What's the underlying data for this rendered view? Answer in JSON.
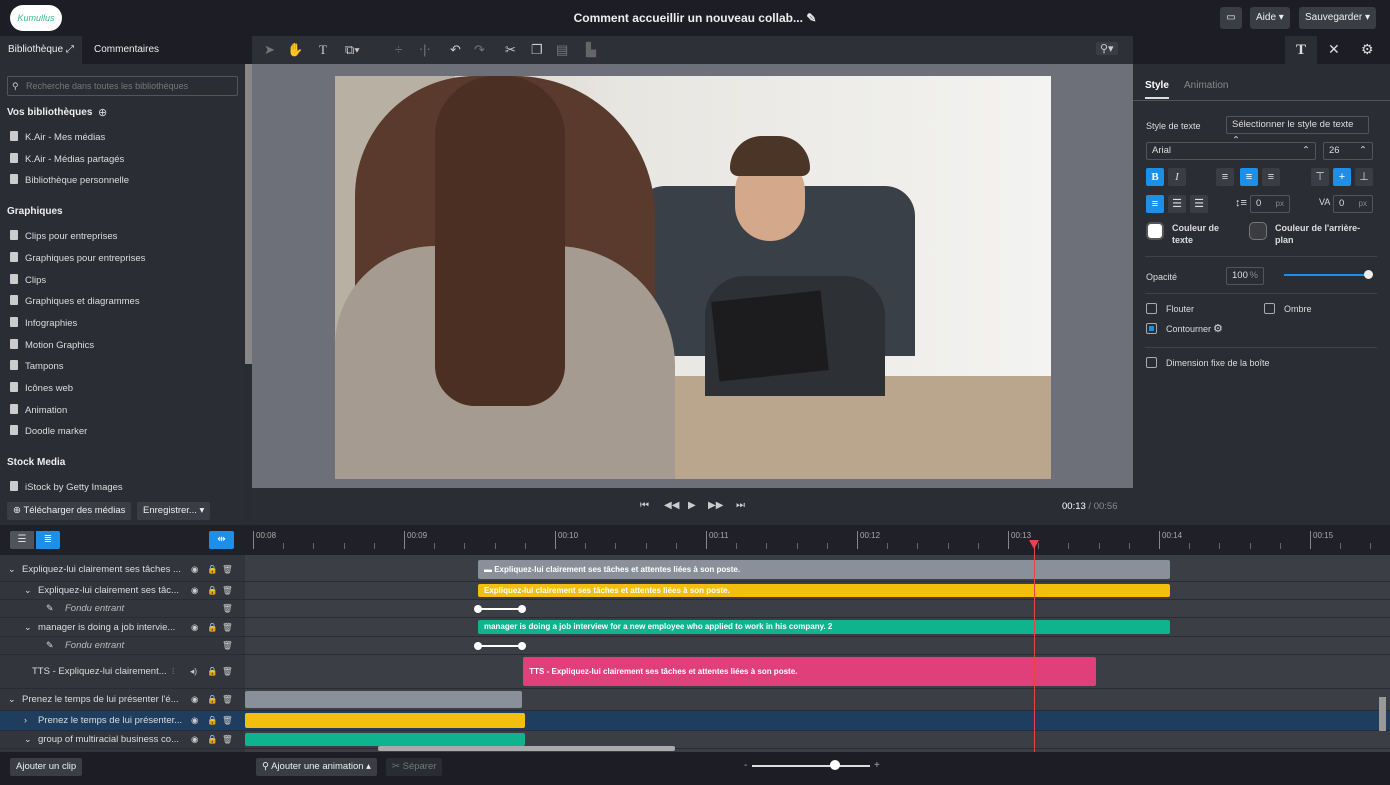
{
  "app": {
    "logo_text": "Kumullus",
    "title": "Comment accueillir un nouveau collab...",
    "help": "Aide",
    "save": "Sauvegarder"
  },
  "left": {
    "tabs": [
      "Bibliothèque",
      "Commentaires"
    ],
    "search_placeholder": "Recherche dans toutes les bibliothèques",
    "sections": [
      {
        "title": "Vos bibliothèques",
        "items": [
          "K.Air - Mes médias",
          "K.Air - Médias partagés",
          "Bibliothèque personnelle"
        ]
      },
      {
        "title": "Graphiques",
        "items": [
          "Clips pour entreprises",
          "Graphiques pour entreprises",
          "Clips",
          "Graphiques et diagrammes",
          "Infographies",
          "Motion Graphics",
          "Tampons",
          "Icônes web",
          "Animation",
          "Doodle marker"
        ]
      },
      {
        "title": "Stock Media",
        "items": [
          "iStock by Getty Images"
        ]
      }
    ],
    "upload": "Télécharger des médias",
    "record": "Enregistrer..."
  },
  "player": {
    "current": "00:13",
    "separator": "/",
    "total": "00:56"
  },
  "right": {
    "tabs": [
      "Style",
      "Animation"
    ],
    "active_tab": "Style",
    "text_style_label": "Style de texte",
    "text_style_value": "Sélectionner le style de texte",
    "font": "Arial",
    "size": "26",
    "line_spacing": "0",
    "letter_spacing": "0",
    "unit": "px",
    "text_color_label": "Couleur de texte",
    "bg_color_label": "Couleur de l'arrière-plan",
    "opacity_label": "Opacité",
    "opacity_value": "100",
    "opacity_unit": "%",
    "opacity": 1.0,
    "checks": [
      {
        "label": "Flouter",
        "checked": false
      },
      {
        "label": "Ombre",
        "checked": false
      },
      {
        "label": "Contourner",
        "checked": true
      },
      {
        "label": "Dimension fixe de la boîte",
        "checked": false
      }
    ]
  },
  "timeline": {
    "ticks": [
      "00:08",
      "00:09",
      "00:10",
      "00:11",
      "00:12",
      "00:13",
      "00:14",
      "00:15"
    ],
    "playhead_seconds": 13.17,
    "rows": [
      {
        "label": "Expliquez-lui clairement ses tâches ...",
        "indent": 0,
        "chev": "v",
        "kind": "group",
        "clip": {
          "text": "Expliquez-lui clairement ses tâches et attentes liées à son poste.",
          "start": 9.49,
          "end": 14.07,
          "color": "#8a9099"
        }
      },
      {
        "label": "Expliquez-lui clairement ses tâc...",
        "indent": 1,
        "chev": "v",
        "kind": "text",
        "clip": {
          "text": "Expliquez-lui clairement ses tâches et attentes liées à son poste.",
          "start": 9.49,
          "end": 14.07,
          "color": "#f2bf0f"
        }
      },
      {
        "label": "Fondu entrant",
        "indent": 2,
        "kind": "anim",
        "fade": {
          "start": 9.49,
          "end": 9.78
        }
      },
      {
        "label": "manager is doing a job intervie...",
        "indent": 1,
        "chev": "v",
        "kind": "video",
        "clip": {
          "text": "manager is doing a job interview for a new employee who applied to work in his company. 2",
          "start": 9.49,
          "end": 14.07,
          "color": "#0fb38e"
        }
      },
      {
        "label": "Fondu entrant",
        "indent": 2,
        "kind": "anim",
        "fade": {
          "start": 9.49,
          "end": 9.78
        }
      },
      {
        "label": "TTS - Expliquez-lui clairement...",
        "indent": 1,
        "kind": "tts",
        "clip": {
          "text": "TTS - Expliquez-lui clairement ses tâches et attentes liées à son poste.",
          "start": 9.79,
          "end": 13.58,
          "color": "#e0407a"
        }
      },
      {
        "label": "Prenez le temps de lui présenter l'é...",
        "indent": 0,
        "chev": "v",
        "kind": "group",
        "clip": {
          "text": "",
          "start": 7.95,
          "end": 9.78,
          "color": "#8a9099"
        }
      },
      {
        "label": "Prenez le temps de lui présenter...",
        "indent": 1,
        "chev": ">",
        "kind": "text",
        "selected": true,
        "clip": {
          "text": "",
          "start": 7.95,
          "end": 9.8,
          "color": "#f2bf0f"
        }
      },
      {
        "label": "group of multiracial business co...",
        "indent": 1,
        "chev": "v",
        "kind": "video",
        "clip": {
          "text": "",
          "start": 7.95,
          "end": 9.8,
          "color": "#0fb38e"
        }
      }
    ]
  },
  "bottom": {
    "add_clip": "Ajouter un clip",
    "add_animation": "Ajouter une animation",
    "split": "Séparer",
    "zoom_minus": "-",
    "zoom_plus": "+",
    "zoom_level": 0.7
  },
  "colors": {
    "accent": "#1e8fe6",
    "playhead": "#e8424a"
  }
}
